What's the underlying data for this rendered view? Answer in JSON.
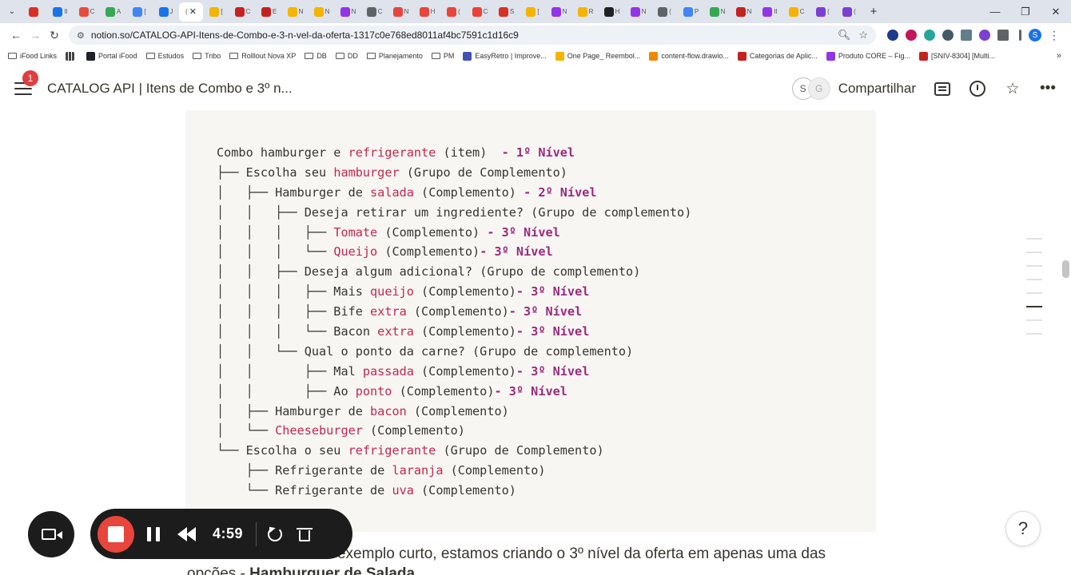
{
  "browser": {
    "active_tab_label": "(",
    "tabs": [
      {
        "label": "",
        "color": "#d93025"
      },
      {
        "label": "II",
        "color": "#1a73e8"
      },
      {
        "label": "C",
        "color": "#e84b3c"
      },
      {
        "label": "A",
        "color": "#34a853"
      },
      {
        "label": "[",
        "color": "#4285f4"
      },
      {
        "label": "J",
        "color": "#1a73e8"
      },
      {
        "label": "[",
        "color": "#f4b400"
      },
      {
        "label": "C",
        "color": "#c5221f"
      },
      {
        "label": "E",
        "color": "#c5221f"
      },
      {
        "label": "N",
        "color": "#f4b400"
      },
      {
        "label": "N",
        "color": "#f4b400"
      },
      {
        "label": "N",
        "color": "#9334e6"
      },
      {
        "label": "C",
        "color": "#5f6368"
      },
      {
        "label": "N",
        "color": "#e8453c"
      },
      {
        "label": "H",
        "color": "#e8453c"
      },
      {
        "label": "(",
        "color": "#e8453c"
      },
      {
        "label": "C",
        "color": "#ea4335"
      },
      {
        "label": "S",
        "color": "#d93025"
      },
      {
        "label": "[",
        "color": "#f4b400"
      },
      {
        "label": "N",
        "color": "#9334e6"
      },
      {
        "label": "R",
        "color": "#f4b400"
      },
      {
        "label": "H",
        "color": "#202124"
      },
      {
        "label": "N",
        "color": "#9334e6"
      },
      {
        "label": "(",
        "color": "#5f6368"
      },
      {
        "label": "P",
        "color": "#4285f4"
      },
      {
        "label": "N",
        "color": "#34a853"
      },
      {
        "label": "N",
        "color": "#c5221f"
      },
      {
        "label": "II",
        "color": "#9334e6"
      },
      {
        "label": "C",
        "color": "#f4b400"
      },
      {
        "label": "(",
        "color": "#7b3fd3"
      },
      {
        "label": "(",
        "color": "#7b3fd3"
      }
    ],
    "new_tab": "+",
    "window_controls": [
      "—",
      "❐",
      "✕"
    ],
    "url": "notion.so/CATALOG-API-Itens-de-Combo-e-3-n-vel-da-oferta-1317c0e768ed8011af4bc7591c1d16c9",
    "bookmarks": [
      {
        "label": "iFood Links",
        "type": "folder"
      },
      {
        "label": "",
        "type": "apps"
      },
      {
        "label": "Portal iFood",
        "type": "site",
        "color": "#202124"
      },
      {
        "label": "Estudos",
        "type": "folder"
      },
      {
        "label": "Tribo",
        "type": "folder"
      },
      {
        "label": "Rolllout Nova XP",
        "type": "folder"
      },
      {
        "label": "DB",
        "type": "folder"
      },
      {
        "label": "DD",
        "type": "folder"
      },
      {
        "label": "Planejamento",
        "type": "folder"
      },
      {
        "label": "PM",
        "type": "folder"
      },
      {
        "label": "EasyRetro | Improve...",
        "type": "site",
        "color": "#3f51b5"
      },
      {
        "label": "One Page_ Reembol...",
        "type": "site",
        "color": "#f4b400"
      },
      {
        "label": "content-flow.drawio...",
        "type": "site",
        "color": "#f08705"
      },
      {
        "label": "Categorias de Aplic...",
        "type": "site",
        "color": "#c5221f"
      },
      {
        "label": "Produto CORE – Fig...",
        "type": "site",
        "color": "#9334e6"
      },
      {
        "label": "[SNIV-8304] [Multi...",
        "type": "site",
        "color": "#c5221f"
      }
    ],
    "bookmarks_more": "»"
  },
  "notion": {
    "badge_count": "1",
    "page_title": "CATALOG API | Itens de Combo e 3º n...",
    "avatar_1": "S",
    "avatar_2": "G",
    "share_label": "Compartilhar"
  },
  "code_lines": [
    [
      {
        "t": "Combo hamburger e "
      },
      {
        "t": "refrigerante",
        "c": "kw"
      },
      {
        "t": " (item)  "
      },
      {
        "t": "- 1º Nível",
        "c": "lv"
      }
    ],
    [
      {
        "t": "├── Escolha seu "
      },
      {
        "t": "hamburger",
        "c": "kw"
      },
      {
        "t": " (Grupo de Complemento)"
      }
    ],
    [
      {
        "t": "│   ├── Hamburger de "
      },
      {
        "t": "salada",
        "c": "kw"
      },
      {
        "t": " (Complemento) "
      },
      {
        "t": "- 2º Nível",
        "c": "lv"
      }
    ],
    [
      {
        "t": "│   │   ├── Deseja retirar um ingrediente? (Grupo de complemento)"
      }
    ],
    [
      {
        "t": "│   │   │   ├── "
      },
      {
        "t": "Tomate",
        "c": "kw"
      },
      {
        "t": " (Complemento) "
      },
      {
        "t": "- 3º Nível",
        "c": "lv"
      }
    ],
    [
      {
        "t": "│   │   │   └── "
      },
      {
        "t": "Queijo",
        "c": "kw"
      },
      {
        "t": " (Complemento)"
      },
      {
        "t": "- 3º Nível",
        "c": "lv"
      }
    ],
    [
      {
        "t": "│   │   ├── Deseja algum adicional? (Grupo de complemento)"
      }
    ],
    [
      {
        "t": "│   │   │   ├── Mais "
      },
      {
        "t": "queijo",
        "c": "kw"
      },
      {
        "t": " (Complemento)"
      },
      {
        "t": "- 3º Nível",
        "c": "lv"
      }
    ],
    [
      {
        "t": "│   │   │   ├── Bife "
      },
      {
        "t": "extra",
        "c": "kw"
      },
      {
        "t": " (Complemento)"
      },
      {
        "t": "- 3º Nível",
        "c": "lv"
      }
    ],
    [
      {
        "t": "│   │   │   └── Bacon "
      },
      {
        "t": "extra",
        "c": "kw"
      },
      {
        "t": " (Complemento)"
      },
      {
        "t": "- 3º Nível",
        "c": "lv"
      }
    ],
    [
      {
        "t": "│   │   └── Qual o ponto da carne? (Grupo de complemento)"
      }
    ],
    [
      {
        "t": "│   │       ├── Mal "
      },
      {
        "t": "passada",
        "c": "kw"
      },
      {
        "t": " (Complemento)"
      },
      {
        "t": "- 3º Nível",
        "c": "lv"
      }
    ],
    [
      {
        "t": "│   │       ├── Ao "
      },
      {
        "t": "ponto",
        "c": "kw"
      },
      {
        "t": " (Complemento)"
      },
      {
        "t": "- 3º Nível",
        "c": "lv"
      }
    ],
    [
      {
        "t": "│   ├── Hamburger de "
      },
      {
        "t": "bacon",
        "c": "kw"
      },
      {
        "t": " (Complemento)"
      }
    ],
    [
      {
        "t": "│   └── "
      },
      {
        "t": "Cheeseburger",
        "c": "kw"
      },
      {
        "t": " (Complemento)"
      }
    ],
    [
      {
        "t": "└── Escolha o seu "
      },
      {
        "t": "refrigerante",
        "c": "kw"
      },
      {
        "t": " (Grupo de Complemento)"
      }
    ],
    [
      {
        "t": "    ├── Refrigerante de "
      },
      {
        "t": "laranja",
        "c": "kw"
      },
      {
        "t": " (Complemento)"
      }
    ],
    [
      {
        "t": "    └── Refrigerante de "
      },
      {
        "t": "uva",
        "c": "kw"
      },
      {
        "t": " (Complemento)"
      }
    ]
  ],
  "paragraph": {
    "line1": "Para fins de facilitar o exemplo curto, estamos criando o 3º nível da oferta em apenas uma das",
    "line2_prefix": "opções - ",
    "line2_bold": "Hamburguer de Salada"
  },
  "help_label": "?",
  "recorder": {
    "timer": "4:59"
  },
  "colors": {
    "keyword": "#c7254e",
    "level": "#9c2a7e",
    "record": "#e8453c"
  }
}
